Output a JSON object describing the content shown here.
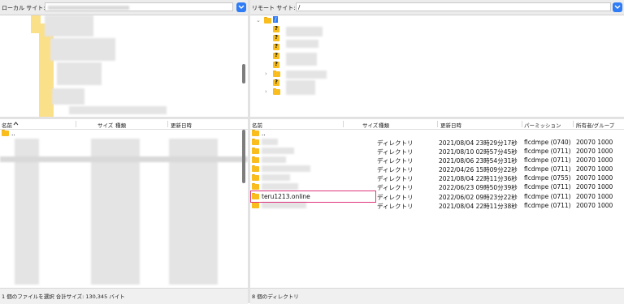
{
  "local": {
    "site_label": "ローカル サイト:",
    "list_columns": [
      "名前",
      "サイズ",
      "種類",
      "更新日時"
    ],
    "parent_entry": "..",
    "status": "1 個のファイルを選択 合計サイズ: 130,345 バイト"
  },
  "remote": {
    "site_label": "リモート サイト:",
    "site_path": "/",
    "list_columns": [
      "名前",
      "サイズ",
      "種類",
      "更新日時",
      "パーミッション",
      "所有者/グループ"
    ],
    "parent_entry": "..",
    "rows": [
      {
        "name": "",
        "type": "ディレクトリ",
        "modified": "2021/08/04 23時29分17秒",
        "permissions": "flcdmpe (0740)",
        "owner": "20070 1000"
      },
      {
        "name": "",
        "type": "ディレクトリ",
        "modified": "2021/08/10 02時57分45秒",
        "permissions": "flcdmpe (0711)",
        "owner": "20070 1000"
      },
      {
        "name": "",
        "type": "ディレクトリ",
        "modified": "2021/08/06 23時54分31秒",
        "permissions": "flcdmpe (0711)",
        "owner": "20070 1000"
      },
      {
        "name": "",
        "type": "ディレクトリ",
        "modified": "2022/04/26 15時09分22秒",
        "permissions": "flcdmpe (0711)",
        "owner": "20070 1000"
      },
      {
        "name": "",
        "type": "ディレクトリ",
        "modified": "2021/08/04 22時11分36秒",
        "permissions": "flcdmpe (0755)",
        "owner": "20070 1000"
      },
      {
        "name": "",
        "type": "ディレクトリ",
        "modified": "2022/06/23 09時50分39秒",
        "permissions": "flcdmpe (0711)",
        "owner": "20070 1000"
      },
      {
        "name": "teru1213.online",
        "type": "ディレクトリ",
        "modified": "2022/06/02 09時23分22秒",
        "permissions": "flcdmpe (0711)",
        "owner": "20070 1000"
      },
      {
        "name": "",
        "type": "ディレクトリ",
        "modified": "2021/08/04 22時11分38秒",
        "permissions": "flcdmpe (0711)",
        "owner": "20070 1000"
      }
    ],
    "status": "8 個のディレクトリ",
    "tree_root": "/",
    "tree_unknown_mark": "?"
  },
  "colors": {
    "accent": "#2f7cf6",
    "folder": "#f9bd1e",
    "highlight": "#e0357b"
  }
}
